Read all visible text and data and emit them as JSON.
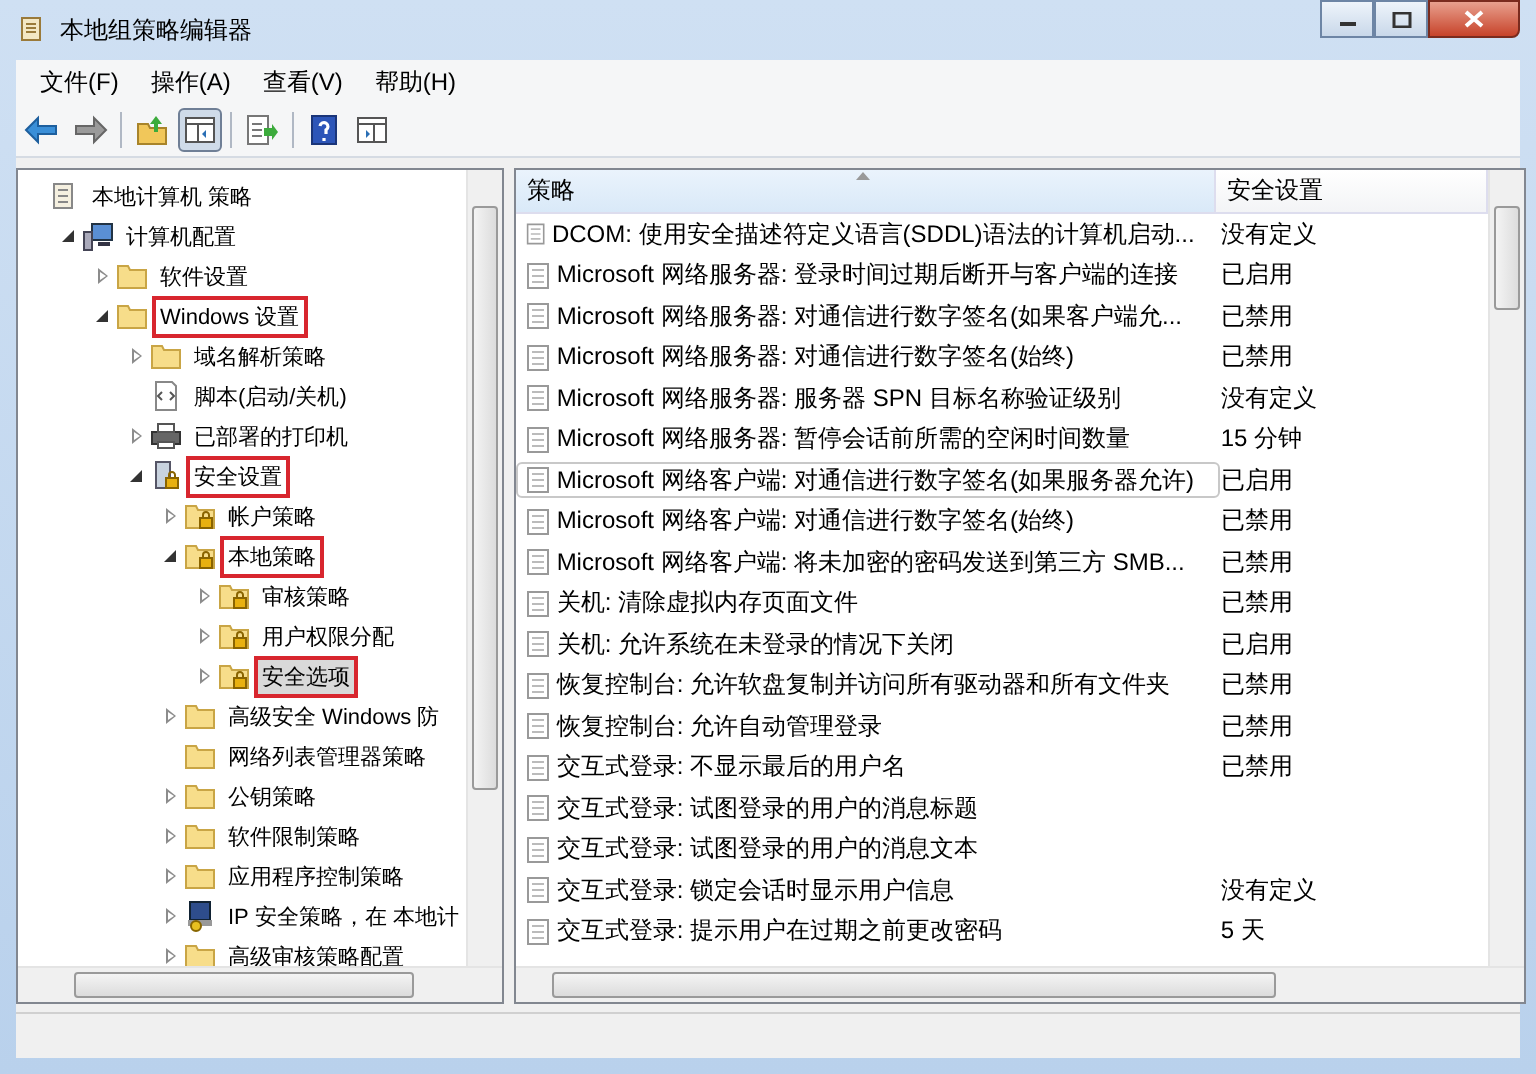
{
  "window": {
    "title": "本地组策略编辑器"
  },
  "menu": [
    {
      "label": "文件(F)"
    },
    {
      "label": "操作(A)"
    },
    {
      "label": "查看(V)"
    },
    {
      "label": "帮助(H)"
    }
  ],
  "toolbar": [
    [
      {
        "kind": "back",
        "pressed": false
      },
      {
        "kind": "forward",
        "pressed": false
      }
    ],
    [
      {
        "kind": "up",
        "pressed": false
      },
      {
        "kind": "tree",
        "pressed": true
      }
    ],
    [
      {
        "kind": "export",
        "pressed": false
      }
    ],
    [
      {
        "kind": "help",
        "pressed": false
      },
      {
        "kind": "pane",
        "pressed": false
      }
    ]
  ],
  "tree": {
    "label": "本地计算机 策略",
    "kind": "policy",
    "selected": false,
    "highlighted": false,
    "children": [
      {
        "label": "计算机配置",
        "kind": "computer",
        "expanded": true,
        "selected": false,
        "highlighted": false,
        "children": [
          {
            "label": "软件设置",
            "kind": "folder",
            "expanded": false,
            "selected": false,
            "highlighted": false
          },
          {
            "label": "Windows 设置",
            "kind": "folder",
            "expanded": true,
            "selected": false,
            "highlighted": true,
            "children": [
              {
                "label": "域名解析策略",
                "kind": "folder",
                "expanded": false,
                "selected": false,
                "highlighted": false
              },
              {
                "label": "脚本(启动/关机)",
                "kind": "script",
                "selected": false,
                "highlighted": false
              },
              {
                "label": "已部署的打印机",
                "kind": "printer",
                "expanded": false,
                "selected": false,
                "highlighted": false
              },
              {
                "label": "安全设置",
                "kind": "security",
                "expanded": true,
                "selected": false,
                "highlighted": true,
                "children": [
                  {
                    "label": "帐户策略",
                    "kind": "lock",
                    "expanded": false,
                    "selected": false,
                    "highlighted": false
                  },
                  {
                    "label": "本地策略",
                    "kind": "lock",
                    "expanded": true,
                    "selected": false,
                    "highlighted": true,
                    "children": [
                      {
                        "label": "审核策略",
                        "kind": "lock",
                        "expanded": false,
                        "selected": false,
                        "highlighted": false
                      },
                      {
                        "label": "用户权限分配",
                        "kind": "lock",
                        "expanded": false,
                        "selected": false,
                        "highlighted": false
                      },
                      {
                        "label": "安全选项",
                        "kind": "lock",
                        "expanded": false,
                        "selected": true,
                        "highlighted": true
                      }
                    ]
                  },
                  {
                    "label": "高级安全 Windows 防",
                    "kind": "folder",
                    "expanded": false,
                    "selected": false,
                    "highlighted": false
                  },
                  {
                    "label": "网络列表管理器策略",
                    "kind": "folder",
                    "selected": false,
                    "highlighted": false
                  },
                  {
                    "label": "公钥策略",
                    "kind": "folder",
                    "expanded": false,
                    "selected": false,
                    "highlighted": false
                  },
                  {
                    "label": "软件限制策略",
                    "kind": "folder",
                    "expanded": false,
                    "selected": false,
                    "highlighted": false
                  },
                  {
                    "label": "应用程序控制策略",
                    "kind": "folder",
                    "expanded": false,
                    "selected": false,
                    "highlighted": false
                  },
                  {
                    "label": "IP 安全策略，在 本地计",
                    "kind": "ip",
                    "expanded": false,
                    "selected": false,
                    "highlighted": false
                  },
                  {
                    "label": "高级审核策略配置",
                    "kind": "folder",
                    "expanded": false,
                    "selected": false,
                    "highlighted": false
                  }
                ]
              }
            ]
          }
        ]
      }
    ]
  },
  "table": {
    "columns": [
      {
        "label": "策略"
      },
      {
        "label": "安全设置"
      }
    ],
    "rows": [
      {
        "policy": "DCOM: 使用安全描述符定义语言(SDDL)语法的计算机启动...",
        "setting": "没有定义",
        "hovered": false
      },
      {
        "policy": "Microsoft 网络服务器: 登录时间过期后断开与客户端的连接",
        "setting": "已启用",
        "hovered": false
      },
      {
        "policy": "Microsoft 网络服务器: 对通信进行数字签名(如果客户端允...",
        "setting": "已禁用",
        "hovered": false
      },
      {
        "policy": "Microsoft 网络服务器: 对通信进行数字签名(始终)",
        "setting": "已禁用",
        "hovered": false
      },
      {
        "policy": "Microsoft 网络服务器: 服务器 SPN 目标名称验证级别",
        "setting": "没有定义",
        "hovered": false
      },
      {
        "policy": "Microsoft 网络服务器: 暂停会话前所需的空闲时间数量",
        "setting": "15 分钟",
        "hovered": false
      },
      {
        "policy": "Microsoft 网络客户端: 对通信进行数字签名(如果服务器允许)",
        "setting": "已启用",
        "hovered": true
      },
      {
        "policy": "Microsoft 网络客户端: 对通信进行数字签名(始终)",
        "setting": "已禁用",
        "hovered": false
      },
      {
        "policy": "Microsoft 网络客户端: 将未加密的密码发送到第三方 SMB...",
        "setting": "已禁用",
        "hovered": false
      },
      {
        "policy": "关机: 清除虚拟内存页面文件",
        "setting": "已禁用",
        "hovered": false
      },
      {
        "policy": "关机: 允许系统在未登录的情况下关闭",
        "setting": "已启用",
        "hovered": false
      },
      {
        "policy": "恢复控制台: 允许软盘复制并访问所有驱动器和所有文件夹",
        "setting": "已禁用",
        "hovered": false
      },
      {
        "policy": "恢复控制台: 允许自动管理登录",
        "setting": "已禁用",
        "hovered": false
      },
      {
        "policy": "交互式登录: 不显示最后的用户名",
        "setting": "已禁用",
        "hovered": false
      },
      {
        "policy": "交互式登录: 试图登录的用户的消息标题",
        "hovered": false
      },
      {
        "policy": "交互式登录: 试图登录的用户的消息文本",
        "hovered": false
      },
      {
        "policy": "交互式登录: 锁定会话时显示用户信息",
        "setting": "没有定义",
        "hovered": false
      },
      {
        "policy": "交互式登录: 提示用户在过期之前更改密码",
        "setting": "5 天",
        "hovered": false
      }
    ]
  }
}
